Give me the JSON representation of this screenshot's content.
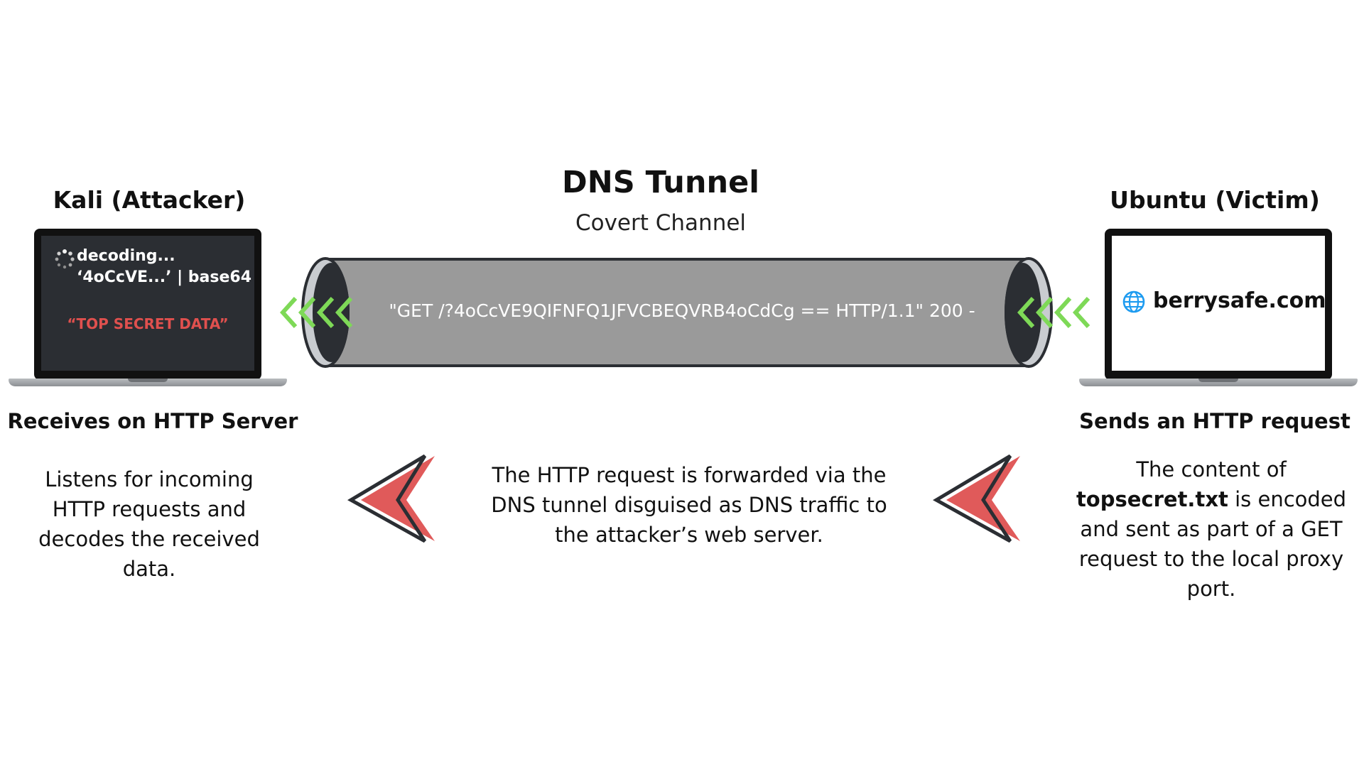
{
  "tunnel": {
    "title": "DNS Tunnel",
    "subtitle": "Covert Channel",
    "request_text": "\"GET /?4oCcVE9QIFNFQ1JFVCBEQVRB4oCdCg == HTTP/1.1\" 200 -"
  },
  "attacker": {
    "title": "Kali (Attacker)",
    "screen": {
      "line1": "decoding...",
      "line2": "‘4oCcVE...’ | base64",
      "secret": "“TOP SECRET DATA”"
    },
    "heading": "Receives on HTTP Server",
    "description": "Listens for incoming HTTP requests and decodes the received data."
  },
  "victim": {
    "title": "Ubuntu (Victim)",
    "screen": {
      "site": "berrysafe.com"
    },
    "heading": "Sends an HTTP request",
    "description_prefix": "The content of",
    "description_file": "topsecret.txt",
    "description_suffix": "is encoded and sent as part of a GET request to the local proxy port."
  },
  "middle": {
    "description": "The HTTP request is forwarded via the DNS tunnel disguised as DNS traffic to the attacker’s web server."
  },
  "colors": {
    "tunnel_fill": "#9a9a9a",
    "tunnel_outline": "#2b2e33",
    "chevron_green": "#7ed957",
    "arrow_red": "#e05a5a",
    "secret_red": "#e0504e",
    "globe_blue": "#1d9bf0"
  },
  "icons": {
    "loading": "loading-spinner-icon",
    "globe": "globe-icon"
  }
}
